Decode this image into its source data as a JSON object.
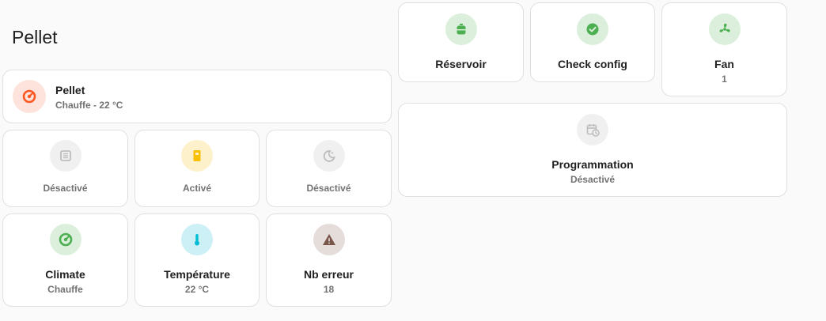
{
  "section": {
    "title": "Pellet"
  },
  "colors": {
    "orange": "#ff5722",
    "orange_bg": "#fde3db",
    "grey": "#bdbdbd",
    "grey_bg": "#f0f0f0",
    "yellow": "#f9c000",
    "yellow_bg": "#fdf1cc",
    "green": "#4caf50",
    "green_bg": "#dcefdc",
    "cyan": "#00bcd4",
    "cyan_bg": "#ccf0f5",
    "brown": "#795548",
    "brown_bg": "#e4ddda"
  },
  "pellet_card": {
    "name": "Pellet",
    "state": "Chauffe - 22 °C",
    "icon": "thermostat-dial-icon"
  },
  "tiles": {
    "t1": {
      "state": "Désactivé",
      "icon": "radiator-icon"
    },
    "t2": {
      "state": "Activé",
      "icon": "stove-icon"
    },
    "t3": {
      "state": "Désactivé",
      "icon": "moon-icon"
    },
    "climate": {
      "name": "Climate",
      "state": "Chauffe",
      "icon": "thermostat-dial-icon"
    },
    "temperature": {
      "name": "Température",
      "state": "22 °C",
      "icon": "thermometer-icon"
    },
    "errors": {
      "name": "Nb erreur",
      "state": "18",
      "icon": "alert-icon"
    },
    "reservoir": {
      "name": "Réservoir",
      "icon": "tank-icon"
    },
    "check_config": {
      "name": "Check config",
      "icon": "check-circle-icon"
    },
    "fan": {
      "name": "Fan",
      "state": "1",
      "icon": "fan-icon"
    },
    "programmation": {
      "name": "Programmation",
      "state": "Désactivé",
      "icon": "calendar-clock-icon"
    }
  }
}
